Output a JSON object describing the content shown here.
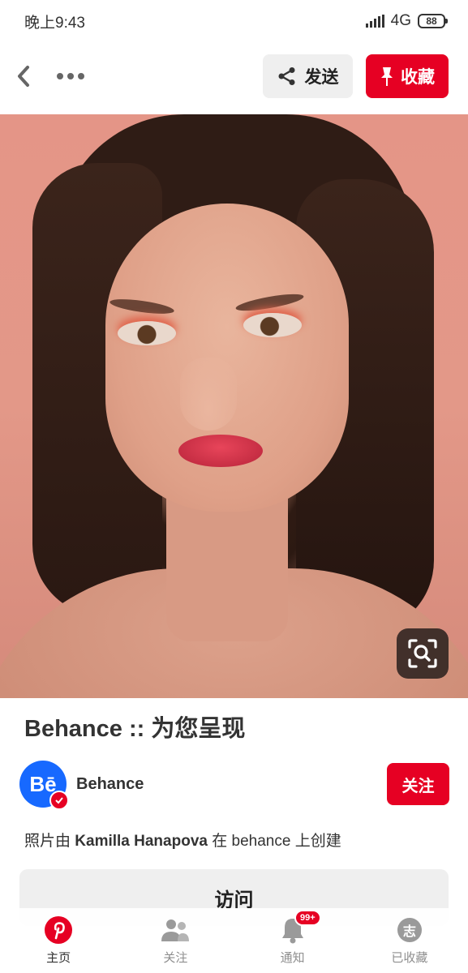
{
  "status_bar": {
    "time": "晚上9:43",
    "network": "4G",
    "battery": "88"
  },
  "top_bar": {
    "send_label": "发送",
    "save_label": "收藏"
  },
  "pin": {
    "title": "Behance :: 为您呈现",
    "creator": {
      "avatar_text": "Bē",
      "name": "Behance",
      "follow_label": "关注"
    },
    "credit": {
      "prefix": "照片由 ",
      "author": "Kamilla Hanapova",
      "suffix": " 在 behance 上创建"
    },
    "visit_label": "访问"
  },
  "bottom_nav": {
    "items": [
      {
        "label": "主页",
        "icon": "pinterest-icon"
      },
      {
        "label": "关注",
        "icon": "people-icon"
      },
      {
        "label": "通知",
        "icon": "bell-icon",
        "badge": "99+"
      },
      {
        "label": "已收藏",
        "icon": "profile-icon",
        "avatar_text": "志"
      }
    ]
  },
  "colors": {
    "brand_red": "#e60023",
    "behance_blue": "#1769ff"
  }
}
